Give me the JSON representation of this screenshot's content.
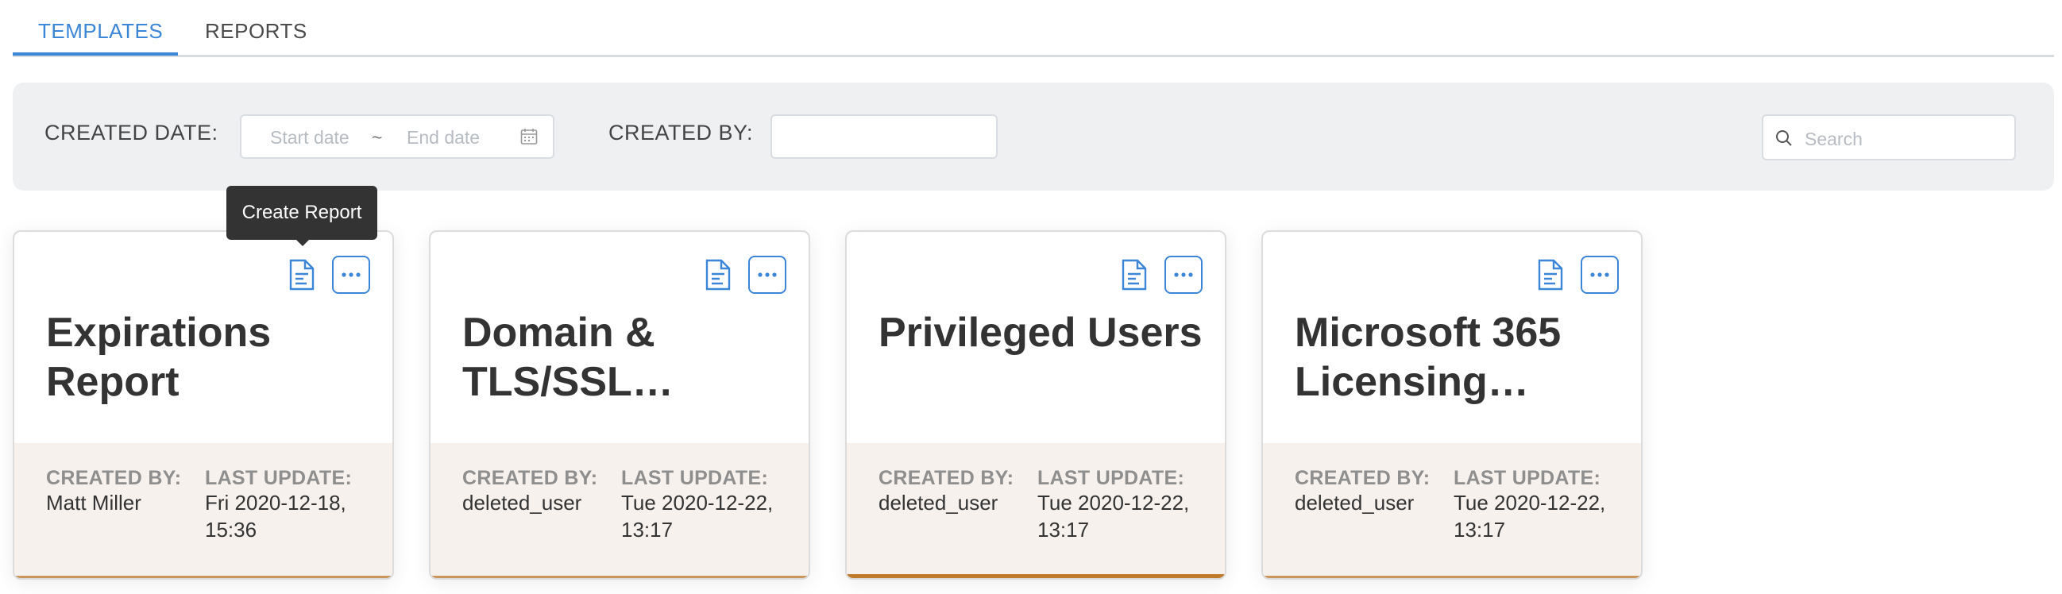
{
  "tabs": [
    {
      "label": "TEMPLATES",
      "active": true
    },
    {
      "label": "REPORTS",
      "active": false
    }
  ],
  "filters": {
    "created_date_label": "CREATED DATE:",
    "start_placeholder": "Start date",
    "separator": "~",
    "end_placeholder": "End date",
    "created_by_label": "CREATED BY:",
    "created_by_value": "",
    "search_placeholder": "Search"
  },
  "tooltip": {
    "text": "Create Report"
  },
  "cards": [
    {
      "title": "Expirations\nReport",
      "created_by_label": "CREATED BY:",
      "created_by": "Matt Miller",
      "last_update_label": "LAST UPDATE:",
      "last_update": "Fri 2020-12-18,\n15:36"
    },
    {
      "title": "Domain &\nTLS/SSL…",
      "created_by_label": "CREATED BY:",
      "created_by": "deleted_user",
      "last_update_label": "LAST UPDATE:",
      "last_update": "Tue 2020-12-22,\n13:17"
    },
    {
      "title": "Privileged Users",
      "created_by_label": "CREATED BY:",
      "created_by": "deleted_user",
      "last_update_label": "LAST UPDATE:",
      "last_update": "Tue 2020-12-22,\n13:17"
    },
    {
      "title": "Microsoft 365\nLicensing…",
      "created_by_label": "CREATED BY:",
      "created_by": "deleted_user",
      "last_update_label": "LAST UPDATE:",
      "last_update": "Tue 2020-12-22,\n13:17"
    }
  ],
  "colors": {
    "accent": "#3b86d6",
    "card_footer": "#f6f1ec",
    "card_bottom_border": "#c9955a"
  },
  "icons": {
    "report": "document-icon",
    "more": "ellipsis-icon",
    "calendar": "calendar-icon",
    "search": "search-icon"
  }
}
